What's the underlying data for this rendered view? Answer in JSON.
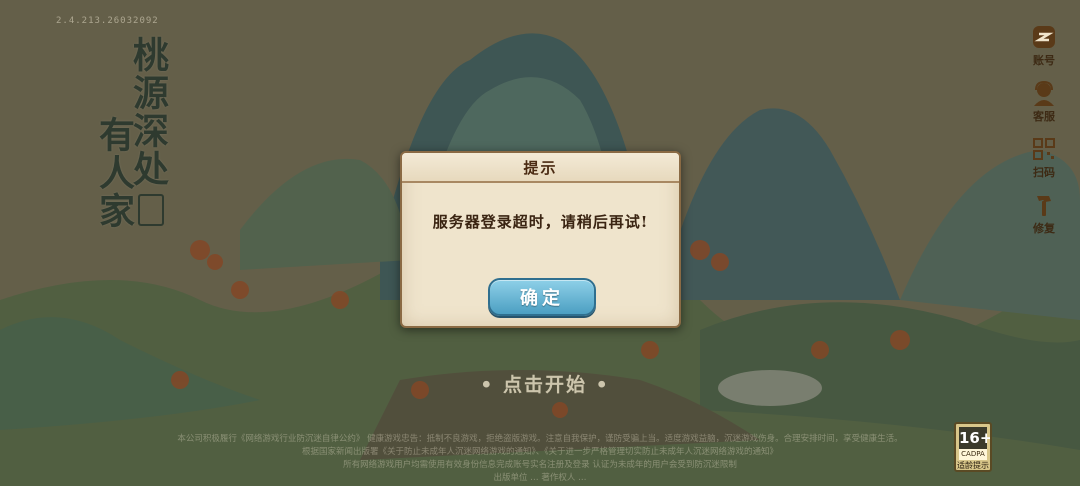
{
  "version": "2.4.213.26032092",
  "game_title": {
    "line1": "桃源深处",
    "line2": "有人家"
  },
  "side_menu": [
    {
      "label": "账号",
      "icon": "account-icon"
    },
    {
      "label": "客服",
      "icon": "customer-service-icon"
    },
    {
      "label": "扫码",
      "icon": "qr-scan-icon"
    },
    {
      "label": "修复",
      "icon": "repair-hammer-icon"
    }
  ],
  "start_prompt": "• 点击开始 •",
  "legal_lines": [
    "本公司积极履行《网络游戏行业防沉迷自律公约》  健康游戏忠告：抵制不良游戏，拒绝盗版游戏。注意自我保护，谨防受骗上当。适度游戏益脑，沉迷游戏伤身。合理安排时间，享受健康生活。",
    "根据国家新闻出版署《关于防止未成年人沉迷网络游戏的通知》、《关于进一步严格管理切实防止未成年人沉迷网络游戏的通知》",
    "所有网络游戏用户均需使用有效身份信息完成账号实名注册及登录  认证为未成年的用户会受到防沉迷限制",
    "出版单位 … 著作权人 …"
  ],
  "age_rating": {
    "age": "16+",
    "sub": "CADPA",
    "tip": "适龄提示"
  },
  "dialog": {
    "title": "提示",
    "message": "服务器登录超时，请稍后再试!",
    "confirm_label": "确定"
  }
}
